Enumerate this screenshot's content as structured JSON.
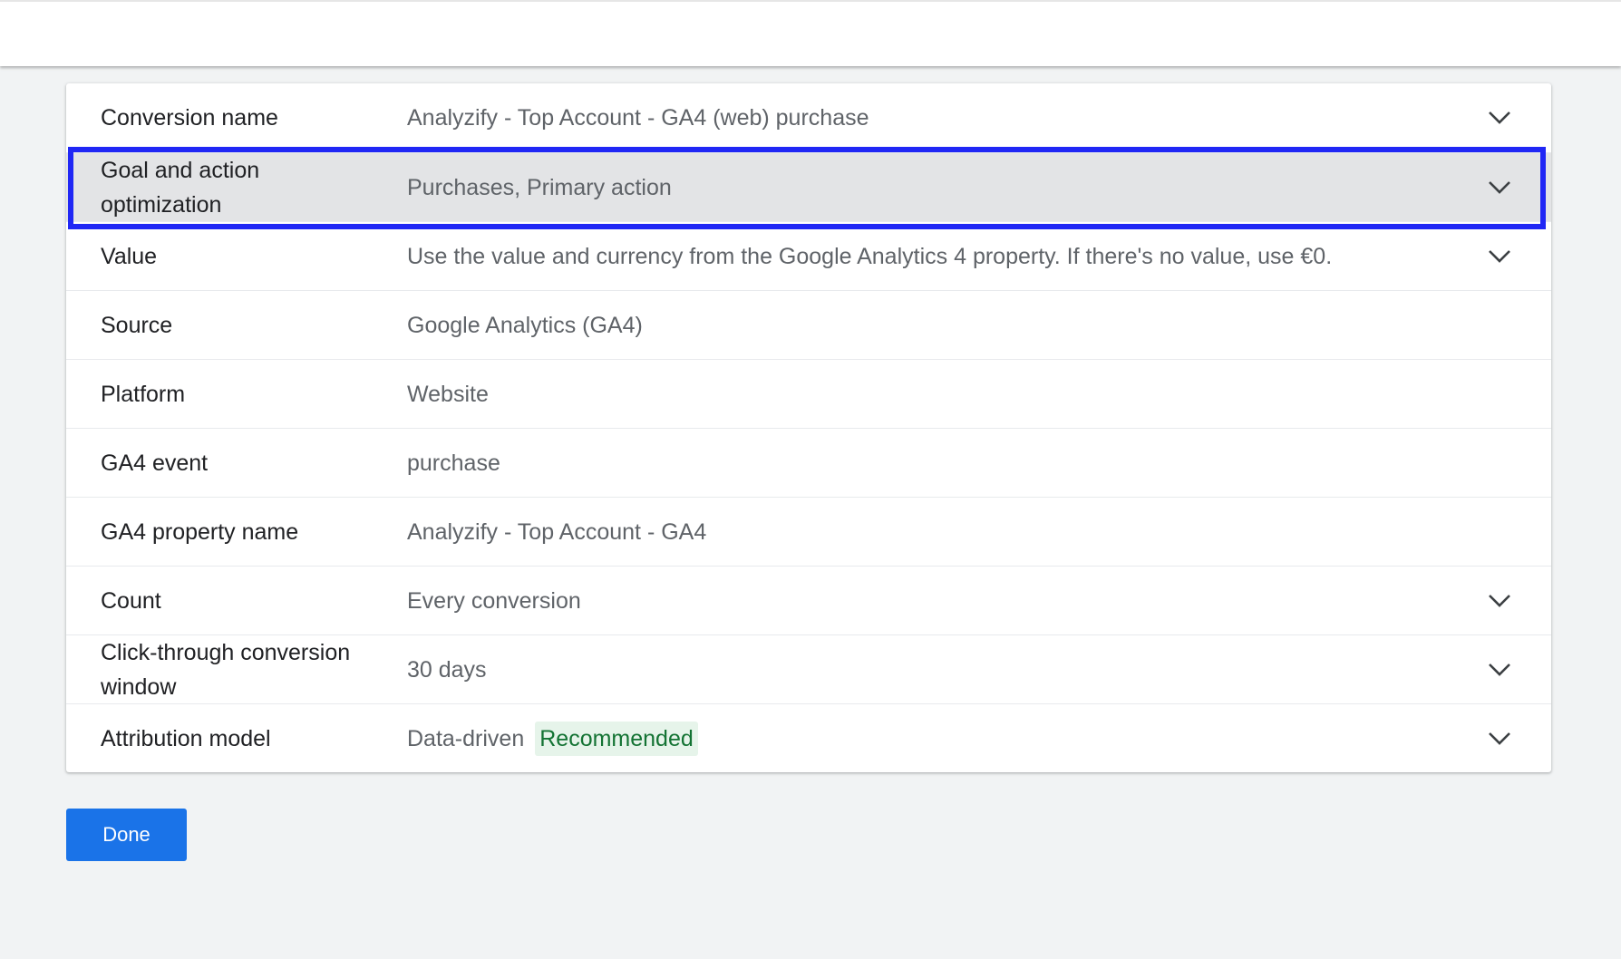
{
  "rows": [
    {
      "label": "Conversion name",
      "value": "Analyzify - Top Account - GA4 (web) purchase",
      "expandable": true
    },
    {
      "label": "Goal and action optimization",
      "value": "Purchases, Primary action",
      "expandable": true,
      "highlighted": true
    },
    {
      "label": "Value",
      "value": "Use the value and currency from the Google Analytics 4 property. If there's no value, use €0.",
      "expandable": true
    },
    {
      "label": "Source",
      "value": "Google Analytics (GA4)",
      "expandable": false
    },
    {
      "label": "Platform",
      "value": "Website",
      "expandable": false
    },
    {
      "label": "GA4 event",
      "value": "purchase",
      "expandable": false
    },
    {
      "label": "GA4 property name",
      "value": "Analyzify - Top Account - GA4",
      "expandable": false
    },
    {
      "label": "Count",
      "value": "Every conversion",
      "expandable": true
    },
    {
      "label": "Click-through conversion window",
      "value": "30 days",
      "expandable": true
    },
    {
      "label": "Attribution model",
      "value": "Data-driven",
      "badge": "Recommended",
      "expandable": true
    }
  ],
  "actions": {
    "done_label": "Done"
  },
  "colors": {
    "highlight_border": "#2027f5",
    "primary_button": "#1a73e8",
    "badge_text": "#137333",
    "badge_background": "#e6f4ea"
  },
  "icons": {
    "expand": "chevron-down-icon"
  }
}
